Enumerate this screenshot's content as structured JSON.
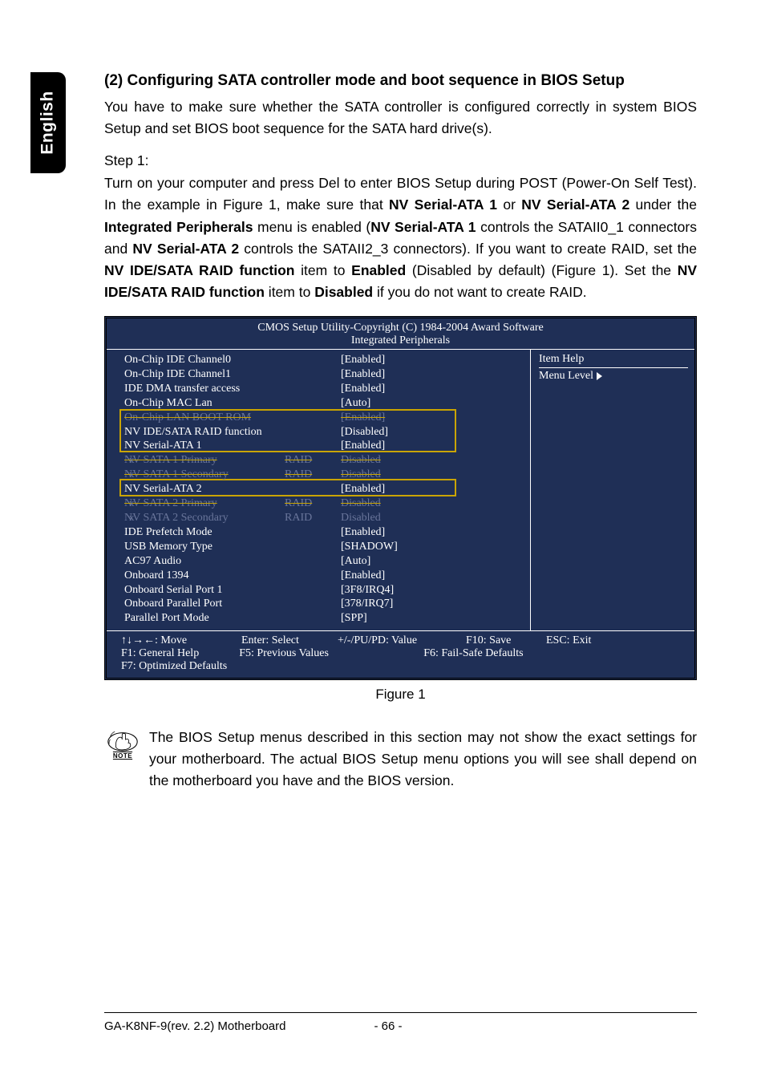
{
  "langTab": "English",
  "sectionTitle": "(2)  Configuring SATA controller mode and boot sequence in BIOS Setup",
  "intro": "You have to make sure whether the SATA controller is configured correctly in system BIOS Setup and set BIOS boot sequence for the SATA hard drive(s).",
  "stepLabel": "Step 1:",
  "para_parts": {
    "p1": "Turn on your computer and press Del to enter BIOS Setup during POST (Power-On Self Test). In the example in Figure 1, make sure that ",
    "b1": "NV Serial-ATA 1",
    "p2": " or ",
    "b2": "NV Serial-ATA 2",
    "p3": " under the ",
    "b3": "Integrated Peripherals",
    "p4": " menu is enabled (",
    "b4": "NV Serial-ATA 1",
    "p5": " controls the SATAII0_1 connectors and ",
    "b5": "NV Serial-ATA 2",
    "p6": " controls the SATAII2_3 connectors). If you want to create RAID, set the ",
    "b6": "NV IDE/SATA RAID function",
    "p7": " item to ",
    "b7": "Enabled",
    "p8": " (Disabled by default) (Figure 1). Set the ",
    "b8": "NV IDE/SATA RAID function",
    "p9": " item to ",
    "b9": "Disabled",
    "p10": " if you do not want to create RAID."
  },
  "bios": {
    "headerLine1": "CMOS Setup Utility-Copyright (C) 1984-2004 Award Software",
    "headerLine2": "Integrated Peripherals",
    "right": {
      "itemHelp": "Item Help",
      "menuLevel": "Menu Level"
    },
    "rows": [
      {
        "c1": "On-Chip IDE Channel0",
        "c2": "",
        "c3": "[Enabled]",
        "cls": ""
      },
      {
        "c1": "On-Chip IDE Channel1",
        "c2": "",
        "c3": "[Enabled]",
        "cls": ""
      },
      {
        "c1": "IDE DMA transfer access",
        "c2": "",
        "c3": "[Enabled]",
        "cls": ""
      },
      {
        "c1": "On-Chip MAC Lan",
        "c2": "",
        "c3": "[Auto]",
        "cls": ""
      },
      {
        "c1": "On-Chip LAN BOOT ROM",
        "c2": "",
        "c3": "[Enabled]",
        "cls": "struck"
      },
      {
        "c1": "NV IDE/SATA RAID function",
        "c2": "",
        "c3": "[Disabled]",
        "cls": ""
      },
      {
        "c1": "NV Serial-ATA 1",
        "c2": "",
        "c3": "[Enabled]",
        "cls": ""
      },
      {
        "c1": "NV SATA 1 Primary",
        "c2": "RAID",
        "c3": "Disabled",
        "cls": "struck",
        "x": true
      },
      {
        "c1": "NV SATA 1 Secondary",
        "c2": "RAID",
        "c3": "Disabled",
        "cls": "struck",
        "x": true
      },
      {
        "c1": "NV Serial-ATA 2",
        "c2": "",
        "c3": "[Enabled]",
        "cls": ""
      },
      {
        "c1": "NV SATA 2 Primary",
        "c2": "RAID",
        "c3": "Disabled",
        "cls": "struck",
        "x": true
      },
      {
        "c1": "NV SATA 2 Secondary",
        "c2": "RAID",
        "c3": "Disabled",
        "cls": "dim",
        "x": true
      },
      {
        "c1": "IDE Prefetch Mode",
        "c2": "",
        "c3": "[Enabled]",
        "cls": ""
      },
      {
        "c1": "USB Memory Type",
        "c2": "",
        "c3": "[SHADOW]",
        "cls": ""
      },
      {
        "c1": "AC97 Audio",
        "c2": "",
        "c3": "[Auto]",
        "cls": ""
      },
      {
        "c1": "Onboard 1394",
        "c2": "",
        "c3": "[Enabled]",
        "cls": ""
      },
      {
        "c1": "Onboard Serial Port 1",
        "c2": "",
        "c3": "[3F8/IRQ4]",
        "cls": ""
      },
      {
        "c1": "Onboard Parallel Port",
        "c2": "",
        "c3": "[378/IRQ7]",
        "cls": ""
      },
      {
        "c1": "Parallel Port Mode",
        "c2": "",
        "c3": "[SPP]",
        "cls": ""
      }
    ],
    "footer": {
      "move": "↑↓→←: Move",
      "enter": "Enter: Select",
      "value": "+/-/PU/PD: Value",
      "save": "F10: Save",
      "esc": "ESC: Exit",
      "help": "F1: General Help",
      "prev": "F5: Previous Values",
      "failsafe": "F6: Fail-Safe Defaults",
      "optimized": "F7: Optimized Defaults"
    }
  },
  "figCaption": "Figure 1",
  "noteLabel": "NOTE",
  "noteText": "The BIOS Setup menus described in this section may not show the exact settings for your motherboard. The actual BIOS Setup menu options you will see shall depend on the motherboard you have and the BIOS version.",
  "footerLeft": "GA-K8NF-9(rev. 2.2) Motherboard",
  "footerCenter": "- 66 -"
}
